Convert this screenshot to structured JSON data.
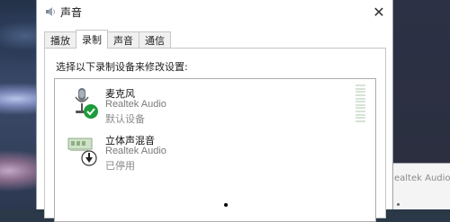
{
  "window": {
    "title": "声音",
    "close_glyph": "✕"
  },
  "tabs": [
    {
      "label": "播放",
      "active": false
    },
    {
      "label": "录制",
      "active": true
    },
    {
      "label": "声音",
      "active": false
    },
    {
      "label": "通信",
      "active": false
    }
  ],
  "recording": {
    "instruction": "选择以下录制设备来修改设置:",
    "devices": [
      {
        "name": "麦克风",
        "driver": "Realtek Audio",
        "status": "默认设备",
        "icon": "microphone-icon",
        "badge": "default-check-icon",
        "badge_color": "#1e9b3a"
      },
      {
        "name": "立体声混音",
        "driver": "Realtek Audio",
        "status": "已停用",
        "icon": "sound-card-icon",
        "badge": "disabled-arrow-icon",
        "badge_color": "#ffffff"
      }
    ]
  },
  "background_window": {
    "partial_text": "ealtek Audio"
  }
}
